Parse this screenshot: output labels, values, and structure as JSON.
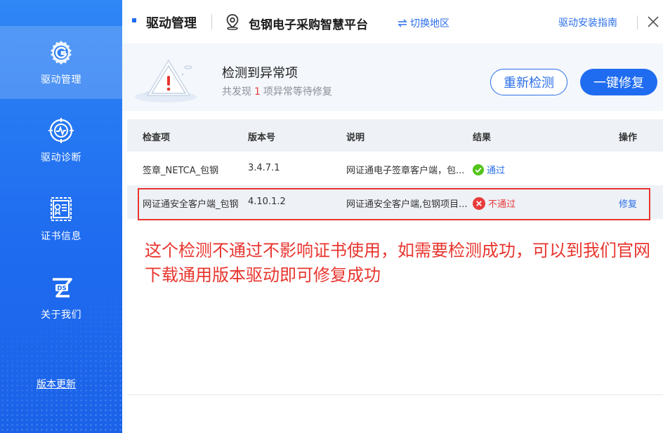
{
  "sidebar": {
    "items": [
      {
        "label": "驱动管理",
        "icon": "gear-g-icon",
        "active": true
      },
      {
        "label": "驱动诊断",
        "icon": "diagnosis-icon",
        "active": false
      },
      {
        "label": "证书信息",
        "icon": "certificate-icon",
        "active": false
      },
      {
        "label": "关于我们",
        "icon": "ds-logo-icon",
        "active": false
      }
    ],
    "version_update": "版本更新"
  },
  "header": {
    "title": "驱动管理",
    "platform": "包钢电子采购智慧平台",
    "switch_region": "切换地区",
    "install_guide": "驱动安装指南"
  },
  "banner": {
    "heading": "检测到异常项",
    "sub_prefix": "共发现",
    "sub_count": "1",
    "sub_suffix": "项异常等待修复",
    "recheck_label": "重新检测",
    "fix_all_label": "一键修复"
  },
  "table": {
    "columns": [
      "检查项",
      "版本号",
      "说明",
      "结果",
      "操作"
    ],
    "rows": [
      {
        "item": "签章_NETCA_包钢",
        "version": "3.4.7.1",
        "desc": "网证通电子签章客户端，包...",
        "result": "通过",
        "status": "pass",
        "action": ""
      },
      {
        "item": "网证通安全客户端_包钢",
        "version": "4.10.1.2",
        "desc": "网证通安全客户端,包钢项目...",
        "result": "不通过",
        "status": "fail",
        "action": "修复"
      }
    ]
  },
  "annotation": "这个检测不通过不影响证书使用，如需要检测成功，可以到我们官网下载通用版本驱动即可修复成功",
  "colors": {
    "primary": "#1f6cf0",
    "link": "#2b6fe8",
    "error": "#e83b3b",
    "success": "#52c41a"
  }
}
